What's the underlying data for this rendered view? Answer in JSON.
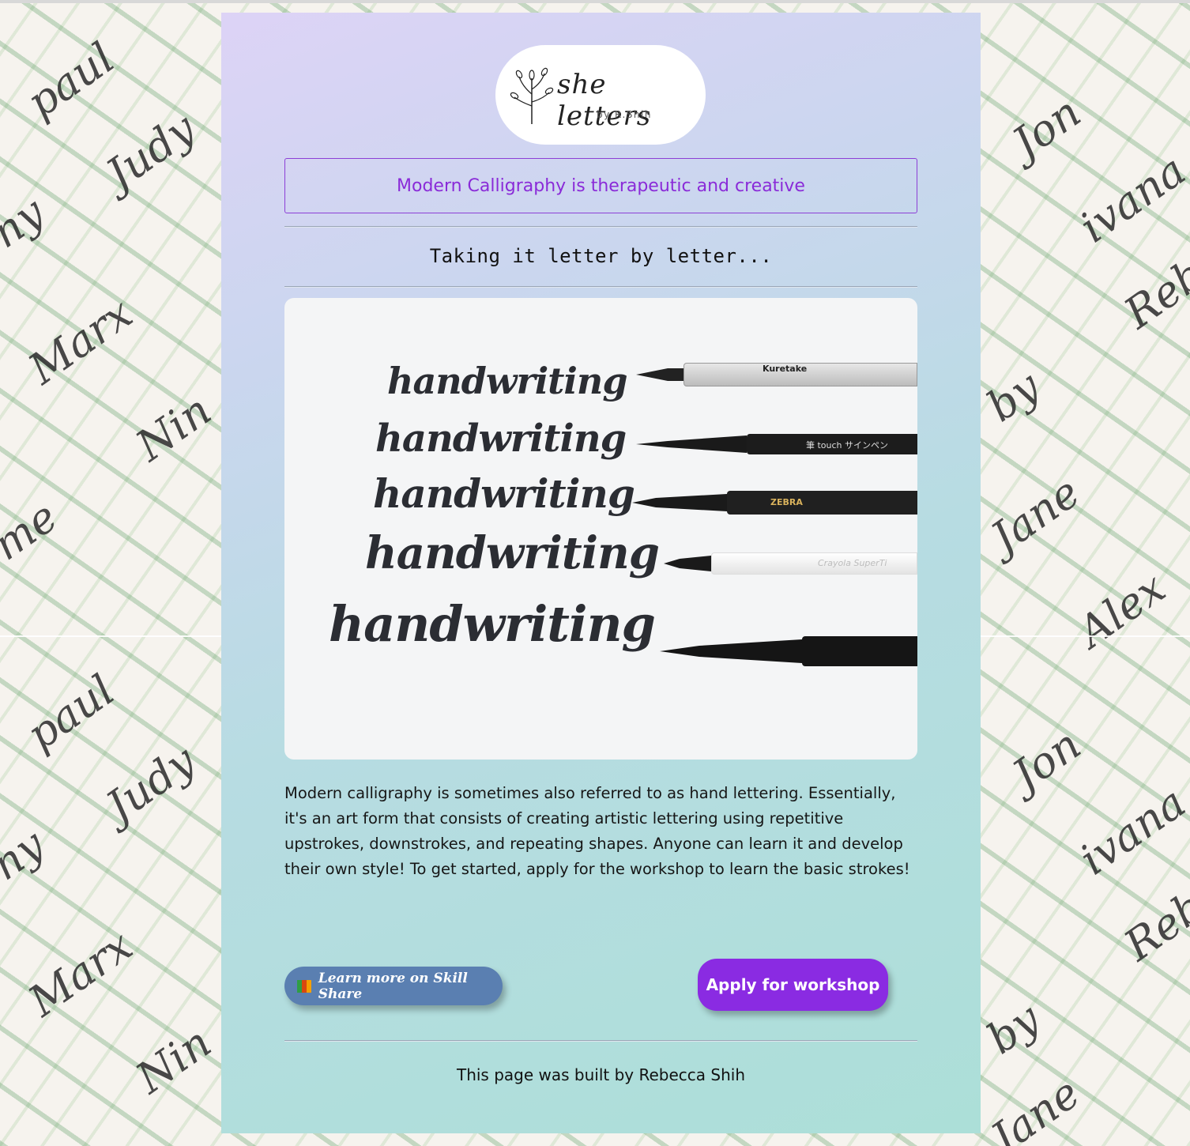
{
  "background": {
    "names": [
      "paul",
      "Judy",
      "ny",
      "Marx",
      "Nin",
      "me",
      "Jon",
      "ivana",
      "Reb",
      "by",
      "Jane",
      "Alex"
    ]
  },
  "logo": {
    "title": "she letters",
    "subtitle": "by R.Shih"
  },
  "tagline": "Modern Calligraphy is therapeutic and creative",
  "subtitle": "Taking it letter by letter...",
  "hero": {
    "words": [
      "handwriting",
      "handwriting",
      "handwriting",
      "handwriting",
      "handwriting"
    ],
    "pen_labels": [
      "Kuretake",
      "筆 touch サインペン",
      "ZEBRA",
      "Crayola SuperTi"
    ]
  },
  "description": "Modern calligraphy is sometimes also referred to as hand lettering. Essentially, it's an art form that consists of creating artistic lettering using repetitive upstrokes, downstrokes, and repeating shapes. Anyone can learn it and develop their own style! To get started, apply for the workshop to learn the basic strokes!",
  "buttons": {
    "skill_share": "Learn more on Skill Share",
    "apply": "Apply for workshop"
  },
  "footer": "This page was built by Rebecca Shih",
  "colors": {
    "accent_purple": "#8a2be2",
    "skill_blue": "#5a7fb1"
  }
}
